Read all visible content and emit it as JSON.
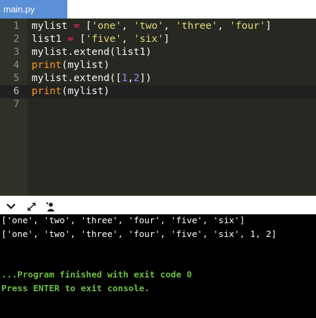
{
  "tab": {
    "label": "main.py"
  },
  "editor": {
    "line_numbers": [
      "1",
      "2",
      "3",
      "4",
      "5",
      "6",
      "7"
    ],
    "active_line": 6
  },
  "console": {
    "output_lines": [
      "['one', 'two', 'three', 'four', 'five', 'six']",
      "['one', 'two', 'three', 'four', 'five', 'six', 1, 2]"
    ],
    "finished_message": "...Program finished with exit code 0",
    "prompt_message": "Press ENTER to exit console."
  },
  "toolbar": {
    "icons": [
      "chevron-down-icon",
      "expand-icon",
      "share-user-icon"
    ]
  }
}
